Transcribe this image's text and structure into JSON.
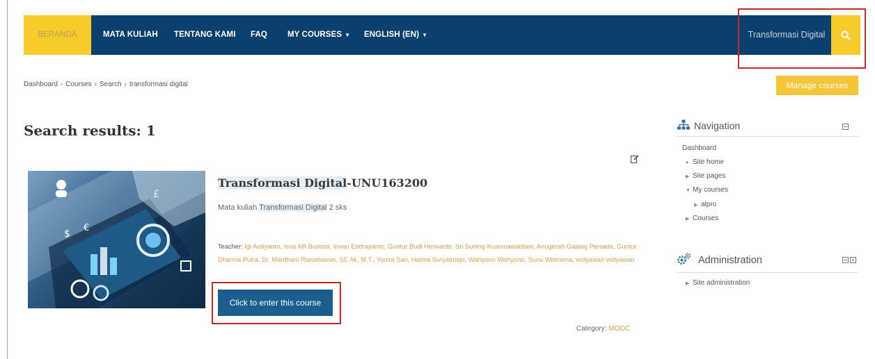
{
  "nav": {
    "items": [
      {
        "label": "BERANDA"
      },
      {
        "label": "MATA KULIAH"
      },
      {
        "label": "TENTANG KAMI"
      },
      {
        "label": "FAQ"
      },
      {
        "label": "MY COURSES"
      },
      {
        "label": "ENGLISH (EN)"
      }
    ],
    "search_value": "Transformasi Digital"
  },
  "breadcrumb": [
    "Dashboard",
    "Courses",
    "Search",
    "transformasi digital"
  ],
  "manage_label": "Manage courses",
  "page_title": "Search results: 1",
  "course": {
    "title_highlight": "Transformasi Digital",
    "title_rest": "-UNU163200",
    "summary_prefix": "Mata kuliah ",
    "summary_highlight": "Transformasi Digital",
    "summary_suffix": " 2 sks",
    "teacher_label": "Teacher:",
    "teachers": "Igi Ardiyanto, Isna Alfi Bustoni, Irwan Endrayanto, Guntur Budi Herwanto, Sri Suning Kusumawardani, Anugerah Galang Persada, Guntur Dharma Putra, Dr. Mardhani Riasetiawan, SE Ak, M.T., Yunita Sari, Hatma Suryatmojo, Wahyono Wahyono, Sunu Wibirama, widyawan widyawan",
    "enter_label": "Click to enter this course",
    "category_label": "Category:",
    "category_value": "MOOC"
  },
  "navigation_block": {
    "title": "Navigation",
    "items": [
      "Dashboard",
      "Site home",
      "Site pages",
      "My courses",
      "alpro",
      "Courses"
    ]
  },
  "admin_block": {
    "title": "Administration",
    "items": [
      "Site administration"
    ]
  },
  "colors": {
    "navbar": "#0b3f6d",
    "accent": "#f5cc2a",
    "button": "#1d5e91",
    "link": "#d9a14a",
    "highlight_box": "#c62828"
  }
}
